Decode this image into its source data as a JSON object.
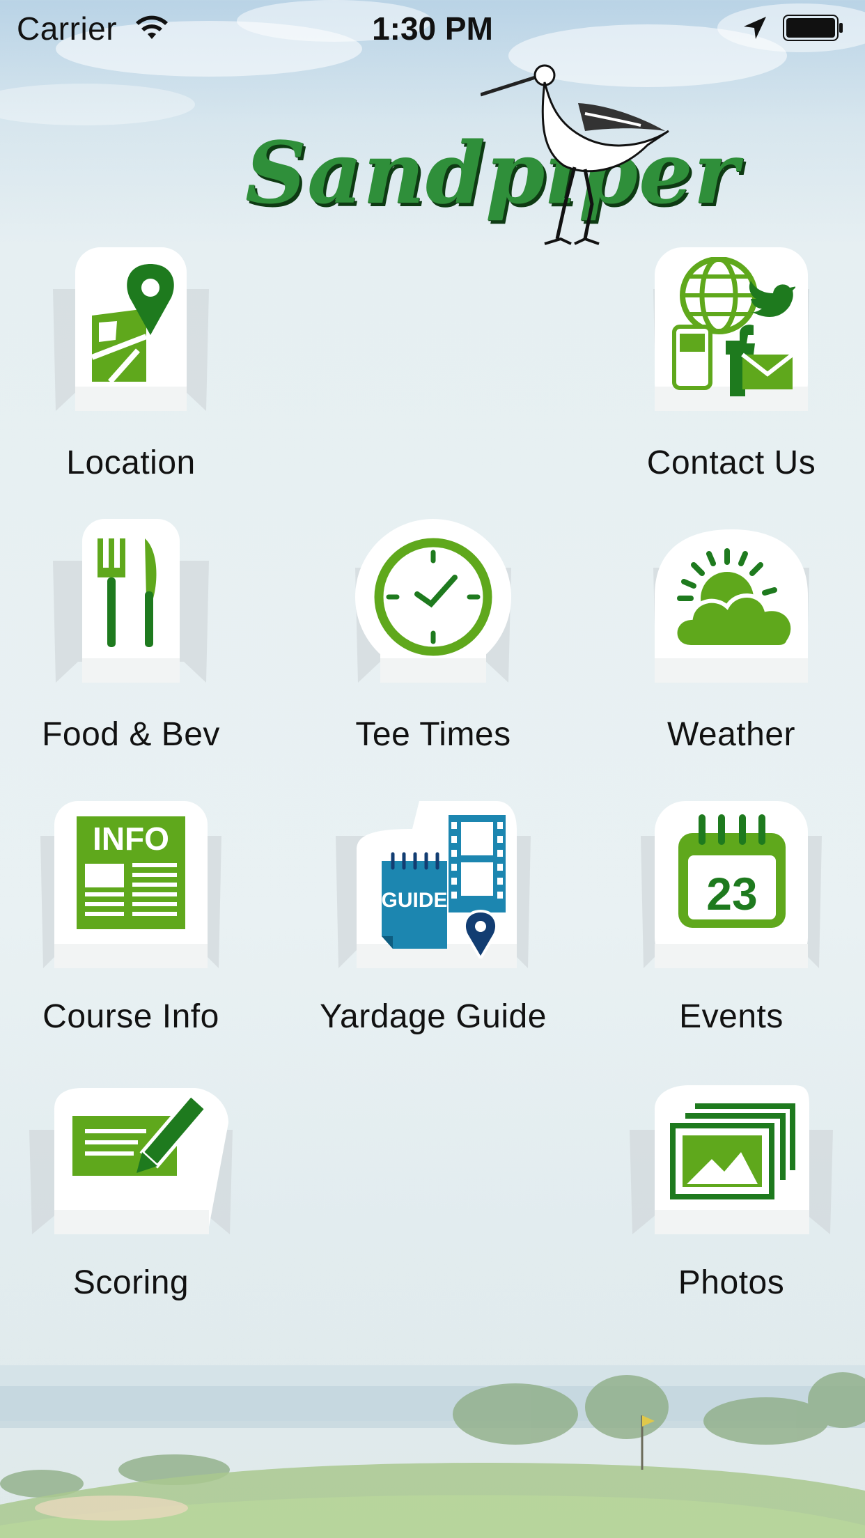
{
  "status_bar": {
    "carrier": "Carrier",
    "time": "1:30 PM",
    "icons": [
      "wifi-icon",
      "location-arrow-icon",
      "battery-icon"
    ]
  },
  "app": {
    "logo_text": "Sandpiper"
  },
  "menu": [
    {
      "id": "location",
      "label": "Location",
      "icon": "map-pin-icon"
    },
    {
      "id": "contact",
      "label": "Contact Us",
      "icon": "contact-social-icon"
    },
    {
      "id": "food",
      "label": "Food & Bev",
      "icon": "fork-knife-icon"
    },
    {
      "id": "tee",
      "label": "Tee Times",
      "icon": "clock-icon"
    },
    {
      "id": "weather",
      "label": "Weather",
      "icon": "sun-cloud-icon"
    },
    {
      "id": "course",
      "label": "Course Info",
      "icon": "info-newspaper-icon"
    },
    {
      "id": "yardage",
      "label": "Yardage Guide",
      "icon": "guide-film-pin-icon"
    },
    {
      "id": "events",
      "label": "Events",
      "icon": "calendar-icon"
    },
    {
      "id": "scoring",
      "label": "Scoring",
      "icon": "scorecard-pencil-icon"
    },
    {
      "id": "photos",
      "label": "Photos",
      "icon": "photos-stack-icon"
    }
  ],
  "icon_text": {
    "info": "INFO",
    "guide": "GUIDE",
    "calendar_day": "23"
  },
  "colors": {
    "icon_green": "#5fa81c",
    "dark_green": "#1e7a1e",
    "guide_blue": "#1c86b0",
    "pin_navy": "#123d72"
  }
}
